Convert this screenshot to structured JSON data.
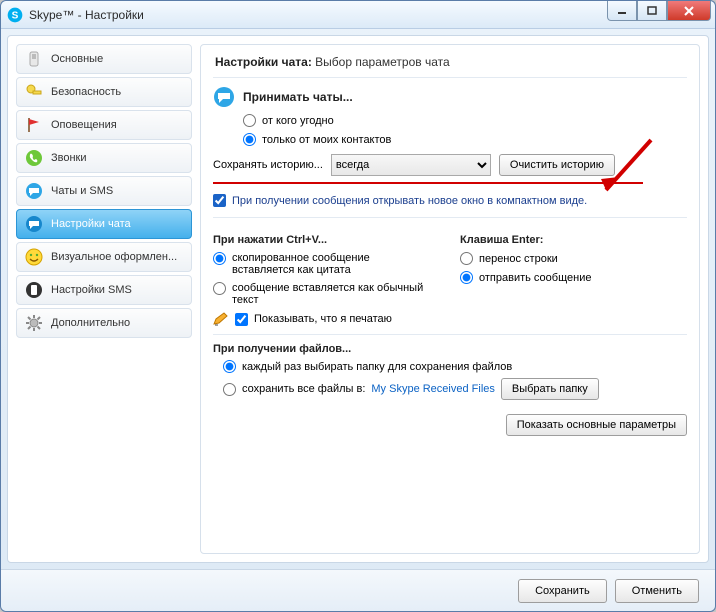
{
  "window_title": "Skype™ - Настройки",
  "sidebar": {
    "items": [
      {
        "label": "Основные",
        "icon": "switch"
      },
      {
        "label": "Безопасность",
        "icon": "key"
      },
      {
        "label": "Оповещения",
        "icon": "flag"
      },
      {
        "label": "Звонки",
        "icon": "phone"
      },
      {
        "label": "Чаты и SMS",
        "icon": "chat"
      },
      {
        "label": "Настройки чата",
        "icon": "chat"
      },
      {
        "label": "Визуальное оформлен...",
        "icon": "smiley"
      },
      {
        "label": "Настройки SMS",
        "icon": "sms"
      },
      {
        "label": "Дополнительно",
        "icon": "gear"
      }
    ]
  },
  "content": {
    "header_bold": "Настройки чата:",
    "header_rest": " Выбор параметров чата",
    "accept_title": "Принимать чаты...",
    "accept_anyone": "от кого угодно",
    "accept_contacts": "только от моих контактов",
    "history_label": "Сохранять историю...",
    "history_value": "всегда",
    "clear_history": "Очистить историю",
    "compact_check": "При получении сообщения открывать новое окно в компактном виде.",
    "ctrlv_title": "При нажатии Ctrl+V...",
    "ctrlv_quote": "скопированное сообщение вставляется как цитата",
    "ctrlv_plain": "сообщение вставляется как обычный текст",
    "enter_title": "Клавиша Enter:",
    "enter_newline": "перенос строки",
    "enter_send": "отправить сообщение",
    "typing_check": "Показывать, что я печатаю",
    "files_title": "При получении файлов...",
    "files_ask": "каждый раз выбирать папку для сохранения файлов",
    "files_save": "сохранить все файлы в:",
    "files_folder": "My Skype Received Files",
    "files_browse": "Выбрать папку",
    "show_basic": "Показать основные параметры"
  },
  "footer": {
    "save": "Сохранить",
    "cancel": "Отменить"
  }
}
